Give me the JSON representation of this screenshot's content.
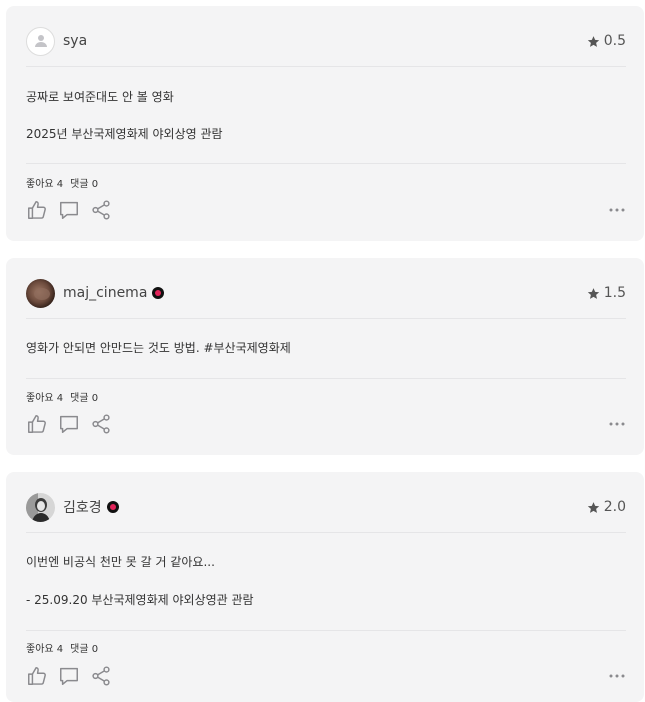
{
  "reviews": [
    {
      "username": "sya",
      "rating": "0.5",
      "has_badge": false,
      "avatar": "default-user-avatar",
      "lines": [
        "공짜로 보여준대도 안 볼 영화",
        "2025년 부산국제영화제 야외상영 관람"
      ],
      "likes_label": "좋아요 4",
      "comments_label": "댓글 0"
    },
    {
      "username": "maj_cinema",
      "rating": "1.5",
      "has_badge": true,
      "avatar": "photo-avatar",
      "lines": [
        "영화가 안되면 안만드는 것도 방법. #부산국제영화제"
      ],
      "likes_label": "좋아요 4",
      "comments_label": "댓글 0"
    },
    {
      "username": "김호경",
      "rating": "2.0",
      "has_badge": true,
      "avatar": "photo-avatar",
      "lines": [
        "이번엔 비공식 천만 못 갈 거 같아요...",
        "- 25.09.20 부산국제영화제 야외상영관 관람"
      ],
      "likes_label": "좋아요 4",
      "comments_label": "댓글 0"
    }
  ],
  "icons": {
    "star": "star-icon",
    "like": "thumbs-up-icon",
    "comment": "comment-icon",
    "share": "share-icon",
    "more": "more-icon"
  },
  "colors": {
    "card_bg": "#f4f4f5",
    "badge_dot": "#e2245a",
    "icon_gray": "#8a8a8e"
  }
}
